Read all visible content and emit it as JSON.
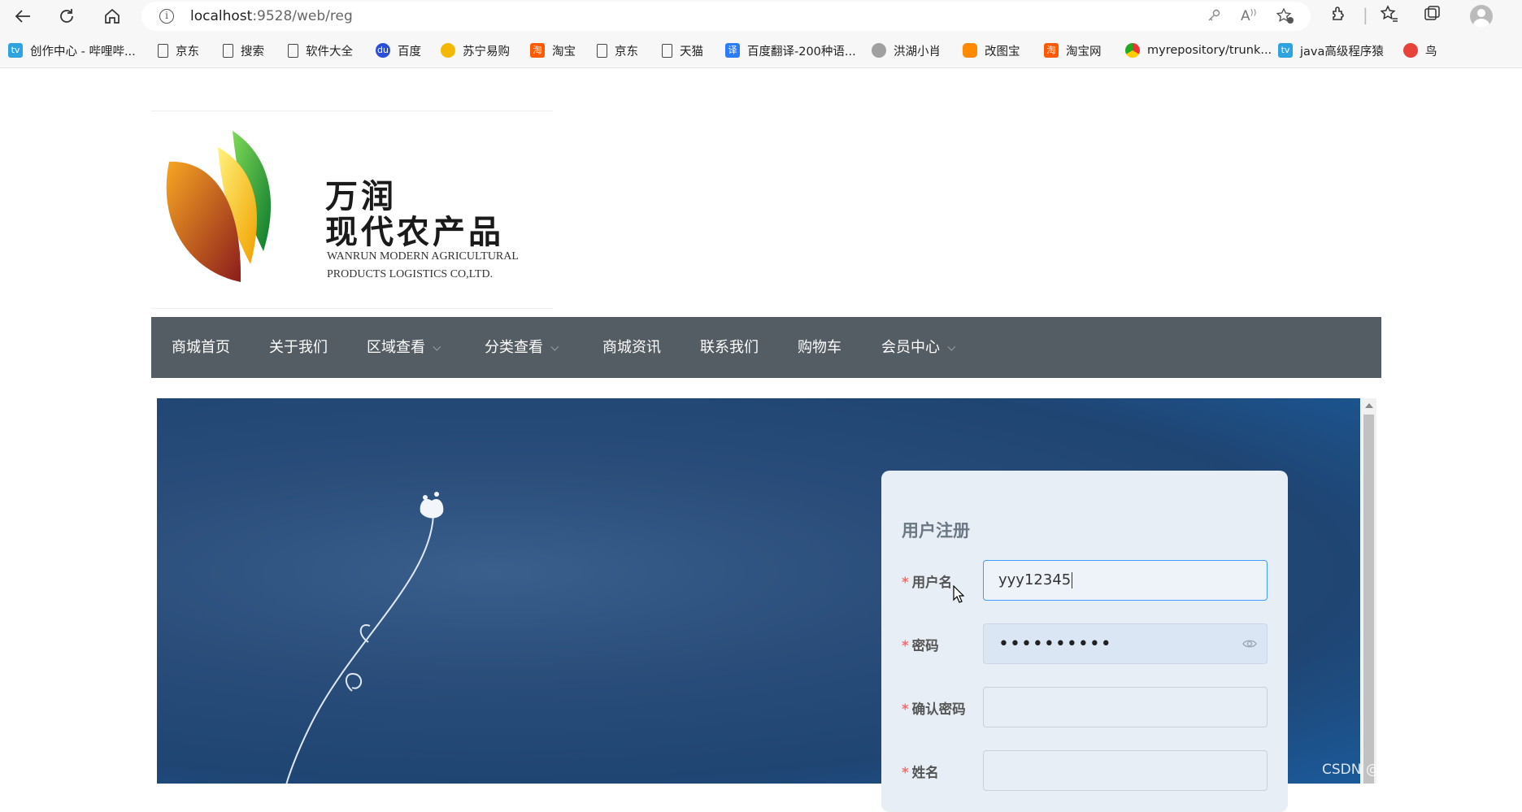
{
  "browser": {
    "url_host": "localhost",
    "url_rest": ":9528/web/reg"
  },
  "bookmarks": [
    {
      "label": "创作中心 - 哔哩哔...",
      "icon": "bilibili-icon"
    },
    {
      "label": "京东",
      "icon": "page-icon"
    },
    {
      "label": "搜索",
      "icon": "page-icon"
    },
    {
      "label": "软件大全",
      "icon": "page-icon"
    },
    {
      "label": "百度",
      "icon": "baidu-icon"
    },
    {
      "label": "苏宁易购",
      "icon": "suning-icon"
    },
    {
      "label": "淘宝",
      "icon": "taobao-icon"
    },
    {
      "label": "京东",
      "icon": "page-icon"
    },
    {
      "label": "天猫",
      "icon": "page-icon"
    },
    {
      "label": "百度翻译-200种语...",
      "icon": "translate-icon"
    },
    {
      "label": "洪湖小肖",
      "icon": "bird-icon"
    },
    {
      "label": "改图宝",
      "icon": "gaitubao-icon"
    },
    {
      "label": "淘宝网",
      "icon": "taobao-icon"
    },
    {
      "label": "myrepository/trunk...",
      "icon": "chrome-icon"
    },
    {
      "label": "java高级程序猿",
      "icon": "bilibili-icon"
    },
    {
      "label": "鸟",
      "icon": "red-bird-icon"
    }
  ],
  "logo": {
    "cn_line1": "万润",
    "cn_line2": "现代农产品",
    "en_line1": "WANRUN MODERN AGRICULTURAL",
    "en_line2": "PRODUCTS  LOGISTICS CO,LTD."
  },
  "nav": {
    "items": [
      {
        "label": "商城首页"
      },
      {
        "label": "关于我们"
      },
      {
        "label": "区域查看"
      },
      {
        "label": "分类查看"
      },
      {
        "label": "商城资讯"
      },
      {
        "label": "联系我们"
      },
      {
        "label": "购物车"
      },
      {
        "label": "会员中心"
      }
    ]
  },
  "form": {
    "title": "用户注册",
    "required_mark": "*",
    "username_label": "用户名",
    "username_value": "yyy12345",
    "password_label": "密码",
    "password_value": "••••••••••",
    "confirm_label": "确认密码",
    "confirm_value": "",
    "name_label": "姓名",
    "name_value": ""
  },
  "watermark": "CSDN @程序猿毕业分享网"
}
